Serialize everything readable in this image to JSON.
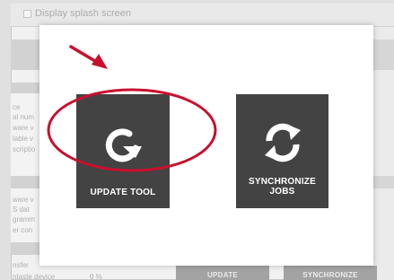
{
  "background": {
    "splash_checkbox_label": "Display splash screen",
    "left_labels": [
      "ce",
      "al num",
      "ware v",
      "lable v",
      "scriptio",
      "ware v",
      "S dat",
      "gramm",
      "er con",
      "nsfer",
      "ntaste device"
    ],
    "bottom_value": "0 %",
    "bottom_buttons": [
      "UPDATE",
      "SYNCHRONIZE"
    ]
  },
  "modal": {
    "tiles": [
      {
        "label": "UPDATE TOOL",
        "icon": "refresh-icon"
      },
      {
        "label_line1": "SYNCHRONIZE",
        "label_line2": "JOBS",
        "icon": "sync-icon"
      }
    ]
  },
  "annotations": {
    "color": "#c8102e",
    "arrow_icon": "arrow-icon",
    "highlight": "ellipse"
  },
  "colors": {
    "tile_bg": "#434343",
    "modal_bg": "#ffffff",
    "overlay_bg": "#d9d9d9"
  }
}
